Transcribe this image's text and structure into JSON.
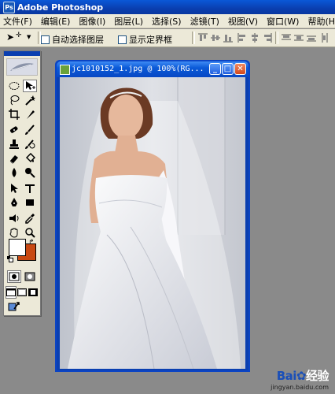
{
  "app": {
    "title": "Adobe Photoshop",
    "icon": "photoshop-app-icon"
  },
  "menu": [
    "文件(F)",
    "编辑(E)",
    "图像(I)",
    "图层(L)",
    "选择(S)",
    "滤镜(T)",
    "视图(V)",
    "窗口(W)",
    "帮助(H)"
  ],
  "options": {
    "auto_select_label": "自动选择图层",
    "show_bounds_label": "显示定界框"
  },
  "document": {
    "title": "jc1010152_1.jpg @ 100%(RG..."
  },
  "toolbox": {
    "foreground_color": "#ffffff",
    "background_color": "#c84812"
  },
  "watermark": {
    "brand_a": "Bai",
    "brand_b": "经验",
    "url": "jingyan.baidu.com"
  },
  "colors": {
    "title_bar": "#0a3fb0",
    "workspace": "#8a8a8a",
    "chrome": "#ece9d8"
  }
}
